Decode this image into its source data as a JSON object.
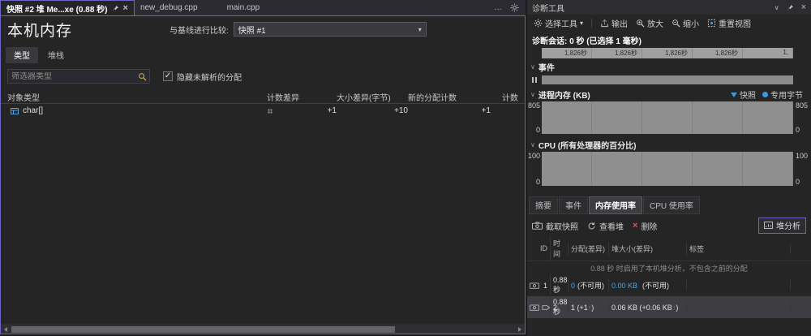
{
  "editor": {
    "tabs": {
      "snapshot": {
        "label": "快照 #2 堆 Me...xe (0.88 秒)"
      },
      "new_debug": {
        "label": "new_debug.cpp"
      },
      "main": {
        "label": "main.cpp"
      }
    },
    "overflow": "…",
    "close_glyph": "×"
  },
  "memory_view": {
    "title": "本机内存",
    "compare_label": "与基线进行比较:",
    "compare_value": "快照 #1",
    "tabs": {
      "types": "类型",
      "stacks": "堆栈"
    },
    "filter_placeholder": "筛选器类型",
    "hide_unresolved_label": "隐藏未解析的分配",
    "check_glyph": "✓",
    "columns": {
      "object_type": "对象类型",
      "count_diff": "计数差异",
      "size_diff": "大小差异(字节)",
      "new_alloc_count": "新的分配计数",
      "count": "计数"
    },
    "rows": [
      {
        "type": "char[]",
        "count_diff": "+1",
        "size_diff": "+10",
        "new_alloc_count": "+1",
        "count": ""
      }
    ]
  },
  "diagnostics": {
    "title": "诊断工具",
    "window_chevron": "∨",
    "toolbar": {
      "select_tool": "选择工具",
      "select_chevron": "▾",
      "export": "输出",
      "zoom_in": "放大",
      "zoom_out": "缩小",
      "reset_view": "重置视图"
    },
    "session_text": "诊断会话: 0 秒 (已选择 1 毫秒)",
    "ruler_ticks": [
      "1,826秒",
      "1,826秒",
      "1,826秒",
      "1,826秒",
      "1,"
    ],
    "sections": {
      "events_title": "事件",
      "memory_title": "进程内存 (KB)",
      "legend_snapshot": "快照",
      "legend_private_bytes": "专用字节",
      "memory_y_max": "805",
      "memory_y_min": "0",
      "cpu_title": "CPU (所有处理器的百分比)",
      "cpu_y_max": "100",
      "cpu_y_min": "0"
    },
    "bottom_tabs": {
      "summary": "摘要",
      "events": "事件",
      "memory_usage": "内存使用率",
      "cpu_usage": "CPU 使用率"
    },
    "snapshot_toolbar": {
      "take_snapshot": "截取快照",
      "view_heap": "查看堆",
      "delete": "删除",
      "delete_glyph": "×",
      "heap_analysis": "堆分析"
    },
    "snapshot_table": {
      "columns": {
        "id": "ID",
        "time": "时间",
        "alloc_diff": "分配(差异)",
        "heap_size_diff": "堆大小(差异)",
        "tag": "标签"
      },
      "notice": "0.88 秒 时启用了本机堆分析，不包含之前的分配",
      "up_arrow_glyph": "↑",
      "rows": [
        {
          "id": "1",
          "time": "0.88 秒",
          "alloc_link": "0",
          "alloc_suffix": "(不可用)",
          "heap_link": "0.00 KB",
          "heap_suffix": "(不可用)"
        },
        {
          "id": "2",
          "time": "0.88 秒",
          "alloc_text": "1 (+1",
          "alloc_close": ")",
          "heap_text": "0.06 KB (+0.06 KB",
          "heap_close": ")"
        }
      ]
    }
  },
  "colors": {
    "accent_purple": "#6b65c8",
    "link_blue": "#4fa3e0",
    "legend_blue": "#3d9bd6",
    "alert_red": "#d95858"
  }
}
